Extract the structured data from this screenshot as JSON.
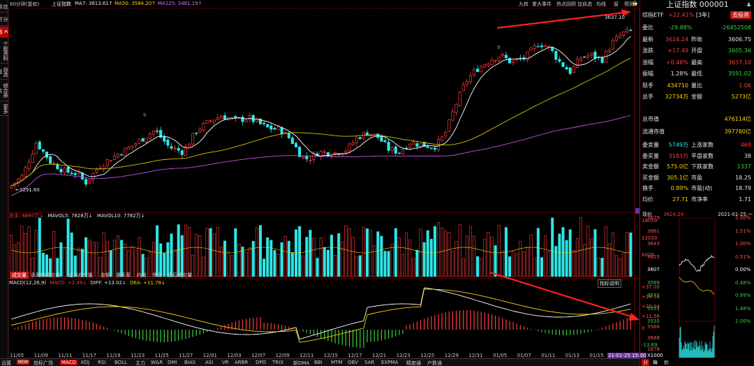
{
  "sidebar": {
    "tabs": [
      "应用",
      "分时图",
      "K线图",
      "个股资料",
      "自选股",
      "综合排名",
      "更多"
    ],
    "active_index": 2
  },
  "toolbar": {
    "period": "60分钟(复权)",
    "title": "上证指数",
    "ma7": "MA7: 3613.61↑",
    "ma50": "MA50: 3584.20↑",
    "ma125": "MA125: 3481.19↑",
    "right_items": [
      "九转",
      "重大事件",
      "热点回顾",
      "加自选",
      "均线",
      "窗",
      "预测"
    ]
  },
  "price_axis": {
    "labels": [
      "3657",
      "3599",
      "3541",
      "3483",
      "3424",
      "3366",
      "3308",
      "3254"
    ],
    "current_tag": "3254"
  },
  "annotations": {
    "low": "←3291.60",
    "high": "3637.10",
    "nine_a": "9",
    "nine_b": "9"
  },
  "volume": {
    "title": "总手: 6897万↓",
    "mavol5": "MAVOL5: 7828万↓",
    "mavol10": "MAVOL10: 7782万↓",
    "axis": [
      "18059",
      "12039",
      "6020"
    ],
    "tabs": [
      "成交量",
      "多周期成交量",
      "虚拟成交量",
      "金额",
      "换手率",
      "内盘",
      "外盘",
      "盘后成交量"
    ],
    "active_tab": 0
  },
  "macd": {
    "title": "MACD(12,26,9)",
    "macd": "MACD: +2.49↓",
    "diff": "DIFF: +13.02↓",
    "dea": "DEA: +11.78↓",
    "help": "指标说明",
    "axis": [
      "+37.00",
      "+28.52",
      "+20.04",
      "+11.56",
      "0",
      "-13.69"
    ]
  },
  "x_axis": {
    "labels": [
      "11/05",
      "11/09",
      "11/11",
      "11/17",
      "11/19",
      "11/23",
      "11/25",
      "11/27",
      "12/01",
      "12/03",
      "12/07",
      "12/09",
      "12/11",
      "12/15",
      "12/17",
      "12/21",
      "12/23",
      "12/25",
      "12/29",
      "12/31",
      "01/05",
      "01/07",
      "01/11",
      "01/13",
      "01/15",
      "01/19"
    ],
    "cursor": "21-01-25 15:00"
  },
  "bottom_tabs": {
    "items": [
      "设置",
      "NEW",
      "指标广场",
      "MACD",
      "KDJ",
      "RSI",
      "BOLL",
      "主力",
      "W&R",
      "DMI",
      "BIAS",
      "ASI",
      "VR",
      "ARBR",
      "DPO",
      "TRIX",
      "新DMA",
      "BBI",
      "MTM",
      "OBV",
      "SAR",
      "EXPMA",
      "精度通",
      "户数通"
    ],
    "active": "MACD"
  },
  "quote": {
    "title": "上证指数",
    "code": "000001",
    "etf_label": "综指ETF",
    "etf_change": "+22.41%",
    "etf_years": "[3年]",
    "etf_btn": "去投资",
    "weibi_label": "委比",
    "weibi_val": "-29.88%",
    "weicha_val": "-26452508",
    "rows": [
      {
        "l1": "最新",
        "v1": "3624.24",
        "l2": "昨收",
        "v2": "3606.75",
        "c1": "red",
        "c2": "white"
      },
      {
        "l1": "涨跌",
        "v1": "+17.49",
        "l2": "开盘",
        "v2": "3605.36",
        "c1": "red",
        "c2": "green"
      },
      {
        "l1": "涨幅",
        "v1": "+0.48%",
        "l2": "最高",
        "v2": "3637.10",
        "c1": "red",
        "c2": "red"
      },
      {
        "l1": "振幅",
        "v1": "1.28%",
        "l2": "最低",
        "v2": "3591.02",
        "c1": "white",
        "c2": "green"
      },
      {
        "l1": "现手",
        "v1": "434710",
        "l2": "量比",
        "v2": "1.06",
        "c1": "yellow",
        "c2": "red"
      },
      {
        "l1": "总手",
        "v1": "32734万",
        "l2": "金额",
        "v2": "5273亿",
        "c1": "yellow",
        "c2": "yellow"
      }
    ],
    "mkt_rows": [
      {
        "l1": "总市值",
        "v1": "476114亿"
      },
      {
        "l1": "流通市值",
        "v1": "397780亿"
      }
    ],
    "breadth_rows": [
      {
        "l1": "委卖量",
        "v1": "5749万",
        "l2": "上涨家数",
        "v2": "469",
        "c1": "cyan",
        "c2": "red"
      },
      {
        "l1": "委买量",
        "v1": "3183万",
        "l2": "平盘家数",
        "v2": "38",
        "c1": "red",
        "c2": "white"
      },
      {
        "l1": "卖金额",
        "v1": "575.0亿",
        "l2": "下跌家数",
        "v2": "1337",
        "c1": "yellow",
        "c2": "green"
      },
      {
        "l1": "买金额",
        "v1": "305.1亿",
        "l2": "市盈",
        "v2": "18.25",
        "c1": "yellow",
        "c2": "white"
      },
      {
        "l1": "换手",
        "v1": "0.89%",
        "l2": "市盈(动)",
        "v2": "18.79",
        "c1": "yellow",
        "c2": "white"
      },
      {
        "l1": "均价",
        "v1": "27.71",
        "l2": "市净率",
        "v2": "1.71",
        "c1": "yellow",
        "c2": "white"
      }
    ]
  },
  "mini": {
    "now_label": "现价",
    "now_val": "3624.24",
    "date": "2021-01-25,一",
    "left_axis": [
      "3679",
      "3661",
      "3643",
      "3625",
      "3607",
      "3589",
      "3571",
      "3553",
      "3535"
    ],
    "right_axis": [
      "2.00%",
      "1.51%",
      "1.00%",
      "0.51%",
      "0.00%",
      "0.48%",
      "0.99%",
      "1.48%",
      "2.00%"
    ],
    "vol_axis": [
      "5566",
      "3688",
      "1878",
      "X1000"
    ],
    "tabs": [
      "分",
      "每",
      "价"
    ]
  }
}
